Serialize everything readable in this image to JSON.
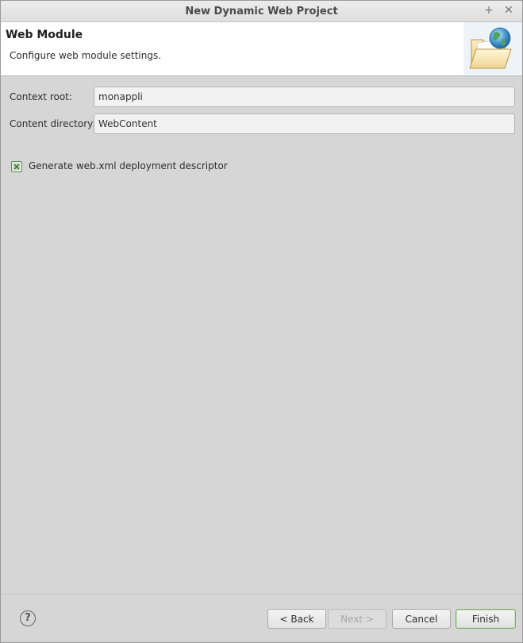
{
  "window": {
    "title": "New Dynamic Web Project",
    "maximize_glyph": "+",
    "close_glyph": "✕"
  },
  "banner": {
    "title": "Web Module",
    "description": "Configure web module settings.",
    "icon": "folder-globe-icon"
  },
  "form": {
    "context_root_label": "Context root:",
    "context_root_value": "monappli",
    "content_directory_label": "Content directory:",
    "content_directory_value": "WebContent"
  },
  "options": {
    "generate_webxml_label": "Generate web.xml deployment descriptor",
    "generate_webxml_checked": true
  },
  "footer": {
    "help_glyph": "?",
    "back_label": "< Back",
    "next_label": "Next >",
    "cancel_label": "Cancel",
    "finish_label": "Finish"
  },
  "colors": {
    "accent_green": "#6e9b5f",
    "background": "#d6d6d6",
    "banner_bg": "#ffffff"
  }
}
